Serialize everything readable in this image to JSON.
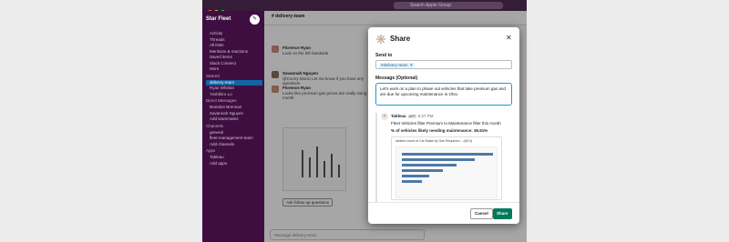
{
  "window": {
    "search_placeholder": "Search Apple Group"
  },
  "sidebar": {
    "workspace": "Star Fleet",
    "items": [
      "Activity",
      "Threads",
      "All DMs",
      "Mentions & reactions",
      "Saved items",
      "Slack Connect",
      "More"
    ],
    "starred_label": "Starred",
    "starred": [
      "delivery-team",
      "Ryan Whelan",
      "Yoshihiro Lo"
    ],
    "dm_label": "Direct Messages",
    "dms": [
      "Brandon Brennan",
      "Savannah Nguyen",
      "Add teammates"
    ],
    "channels_label": "Channels",
    "channels": [
      "general",
      "fleet-management-team",
      "Add channels"
    ],
    "apps_label": "Apps",
    "apps": [
      "Tableau",
      "Add apps"
    ]
  },
  "chat": {
    "channel": "# delivery-team",
    "messages": [
      {
        "name": "Florence Ryan",
        "text": "Look on the left handside"
      },
      {
        "name": "Savannah Nguyen",
        "text": "@Conny Morici Let me know if you have any questions"
      },
      {
        "name": "Florence Ryan",
        "text": "Looks like premium gas prices are really rising this month"
      }
    ],
    "ask_button": "Ask follow up questions",
    "composer_placeholder": "Message delivery-team"
  },
  "modal": {
    "title": "Share",
    "send_to_label": "Send to",
    "recipient": "#delivery-team",
    "message_label": "Message (Optional)",
    "message_text": "Let's work on a plan to phase out vehicles that take premium gas and are due for upcoming maintenance in Ohio",
    "preview": {
      "sender": "Tableau",
      "app_badge": "APP",
      "time": "6:27 PM",
      "line1": "Fleet Vehicles filter Premium to Maintenance filter this month",
      "line2": "% of vehicles likely needing maintenance:  36.51%",
      "chart_title": "distinct count of Car Make by Gas Requirem... (8/14)"
    },
    "cancel_label": "Cancel",
    "share_label": "Share"
  },
  "colors": {
    "aubergine": "#3f0e40",
    "share_green": "#007a5a",
    "link_blue": "#1264a3"
  }
}
